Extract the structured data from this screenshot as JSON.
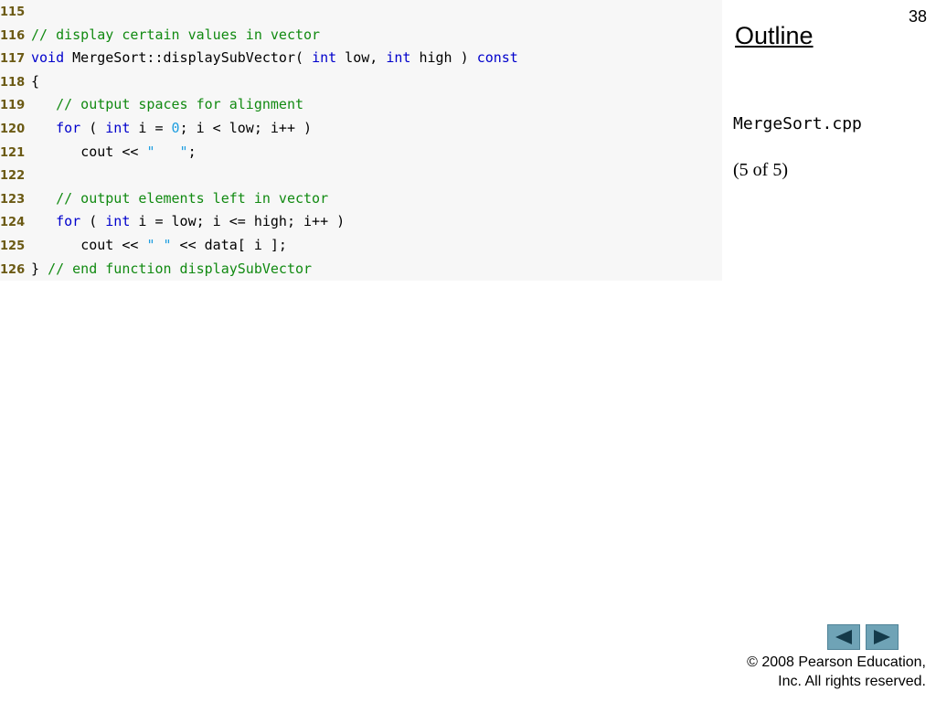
{
  "slide": {
    "page_number": "38",
    "outline_label": "Outline",
    "file_name": "MergeSort.cpp",
    "part_label": "(5 of 5)",
    "copyright_line1": "© 2008 Pearson Education,",
    "copyright_line2": "Inc.  All rights reserved."
  },
  "nav": {
    "prev_icon": "triangle-left",
    "next_icon": "triangle-right"
  },
  "code": {
    "lines": [
      {
        "num": "115",
        "indent": "",
        "tokens": []
      },
      {
        "num": "116",
        "indent": "",
        "tokens": [
          {
            "t": "cm",
            "v": "// display certain values in vector"
          }
        ]
      },
      {
        "num": "117",
        "indent": "",
        "tokens": [
          {
            "t": "kw",
            "v": "void"
          },
          {
            "t": "tx",
            "v": " MergeSort::displaySubVector( "
          },
          {
            "t": "kw",
            "v": "int"
          },
          {
            "t": "tx",
            "v": " low, "
          },
          {
            "t": "kw",
            "v": "int"
          },
          {
            "t": "tx",
            "v": " high ) "
          },
          {
            "t": "kw",
            "v": "const"
          }
        ]
      },
      {
        "num": "118",
        "indent": "",
        "tokens": [
          {
            "t": "tx",
            "v": "{"
          }
        ]
      },
      {
        "num": "119",
        "indent": "   ",
        "tokens": [
          {
            "t": "cm",
            "v": "// output spaces for alignment"
          }
        ]
      },
      {
        "num": "120",
        "indent": "   ",
        "tokens": [
          {
            "t": "kw",
            "v": "for"
          },
          {
            "t": "tx",
            "v": " ( "
          },
          {
            "t": "kw",
            "v": "int"
          },
          {
            "t": "tx",
            "v": " i = "
          },
          {
            "t": "num",
            "v": "0"
          },
          {
            "t": "tx",
            "v": "; i < low; i++ )"
          }
        ]
      },
      {
        "num": "121",
        "indent": "      ",
        "tokens": [
          {
            "t": "tx",
            "v": "cout << "
          },
          {
            "t": "st",
            "v": "\"   \""
          },
          {
            "t": "tx",
            "v": ";"
          }
        ]
      },
      {
        "num": "122",
        "indent": "",
        "tokens": []
      },
      {
        "num": "123",
        "indent": "   ",
        "tokens": [
          {
            "t": "cm",
            "v": "// output elements left in vector"
          }
        ]
      },
      {
        "num": "124",
        "indent": "   ",
        "tokens": [
          {
            "t": "kw",
            "v": "for"
          },
          {
            "t": "tx",
            "v": " ( "
          },
          {
            "t": "kw",
            "v": "int"
          },
          {
            "t": "tx",
            "v": " i = low; i <= high; i++ )"
          }
        ]
      },
      {
        "num": "125",
        "indent": "      ",
        "tokens": [
          {
            "t": "tx",
            "v": "cout << "
          },
          {
            "t": "st",
            "v": "\" \""
          },
          {
            "t": "tx",
            "v": " << data[ i ];"
          }
        ]
      },
      {
        "num": "126",
        "indent": "",
        "tokens": [
          {
            "t": "tx",
            "v": "} "
          },
          {
            "t": "cm",
            "v": "// end function displaySubVector"
          }
        ]
      }
    ]
  },
  "colors": {
    "keyword": "#0000cc",
    "comment": "#118a11",
    "string": "#1e9ee0",
    "line_number": "#6b5a14",
    "nav_button": "#6fa3b6"
  }
}
